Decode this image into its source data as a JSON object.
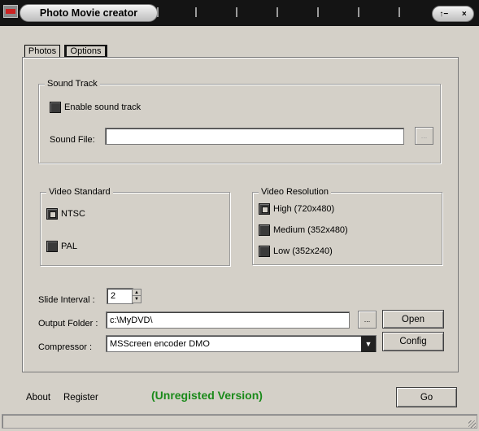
{
  "window": {
    "title": "Photo Movie creator",
    "controls": {
      "restore": "↑−",
      "close": "×"
    }
  },
  "tabs": [
    {
      "label": "Photos"
    },
    {
      "label": "Options"
    }
  ],
  "sound_track": {
    "group_title": "Sound Track",
    "enable_label": "Enable sound track",
    "enable_checked": false,
    "file_label": "Sound File:",
    "file_value": "",
    "browse_label": "..."
  },
  "video_standard": {
    "group_title": "Video Standard",
    "options": [
      {
        "label": "NTSC",
        "selected": true
      },
      {
        "label": "PAL",
        "selected": false
      }
    ]
  },
  "video_resolution": {
    "group_title": "Video Resolution",
    "options": [
      {
        "label": "High (720x480)",
        "selected": true
      },
      {
        "label": "Medium (352x480)",
        "selected": false
      },
      {
        "label": "Low (352x240)",
        "selected": false
      }
    ]
  },
  "slide_interval": {
    "label": "Slide Interval :",
    "value": "2"
  },
  "output_folder": {
    "label": "Output Folder :",
    "value": "c:\\MyDVD\\",
    "browse_label": "...",
    "open_label": "Open"
  },
  "compressor": {
    "label": "Compressor :",
    "value": "MSScreen encoder DMO",
    "config_label": "Config"
  },
  "footer": {
    "about_label": "About",
    "register_label": "Register",
    "unregistered_text": "(Unregisted Version)",
    "go_label": "Go"
  },
  "colors": {
    "titlebar": "#141414",
    "window_bg": "#d4d0c8",
    "unregistered_text": "#1a8a1a"
  },
  "icons": {
    "app_icon": "film-icon",
    "restore_icon": "restore-icon",
    "close_icon": "close-icon",
    "combo_arrow": "chevron-down-icon"
  }
}
